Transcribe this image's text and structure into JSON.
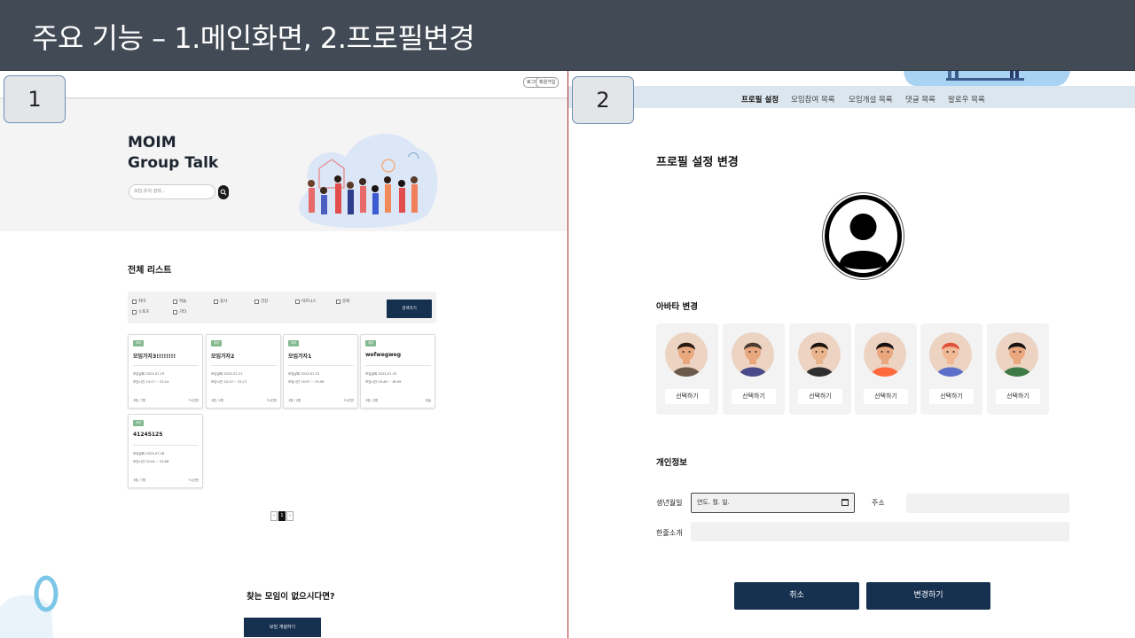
{
  "slide": {
    "title": "주요 기능 – 1.메인화면, 2.프로필변경"
  },
  "labels": {
    "left": "1",
    "right": "2"
  },
  "main": {
    "topbar": {
      "login": "로그인",
      "signup": "회원가입"
    },
    "brand": {
      "line1": "MOIM",
      "line2": "Group Talk"
    },
    "search": {
      "placeholder": "모임,유저 검색..."
    },
    "list_title": "전체 리스트",
    "filters": [
      "취미",
      "학습",
      "봉사",
      "건강",
      "비즈니스",
      "문화",
      "스포츠",
      "기타"
    ],
    "search_button": "검색하기",
    "cards": [
      {
        "tag": "취미",
        "title": "모임가자3!!!!!!!!",
        "line1": "모임날짜 2023-07-19",
        "line2": "모임시간 13:17 ~ 22:14",
        "count": "1명 / 7명",
        "date": "7시간전"
      },
      {
        "tag": "취미",
        "title": "모임가자2",
        "line1": "모임날짜 2023-07-21",
        "line2": "모임시간 10:13 ~ 22:17",
        "count": "1명 / 2명",
        "date": "7시간전"
      },
      {
        "tag": "취미",
        "title": "모임가자1",
        "line1": "모임날짜 2023-07-22",
        "line2": "모임시간 15:57 ~ 23:56",
        "count": "1명 / 2명",
        "date": "7시간전"
      },
      {
        "tag": "취미",
        "title": "wefwegweg",
        "line1": "모임날짜 2023-07-25",
        "line2": "모임시간 03:48 ~ 18:49",
        "count": "1명 / 2명",
        "date": "오늘"
      },
      {
        "tag": "취미",
        "title": "41245125",
        "line1": "모임날짜 2023-07-28",
        "line2": "모임시간 22:04 ~ 23:08",
        "count": "1명 / 7명",
        "date": "7시간전"
      }
    ],
    "pagination": {
      "prev": "‹",
      "current": "1",
      "next": "›"
    },
    "not_found": "찾는 모임이 없으시다면?",
    "create_button": "모임 개설하기"
  },
  "profile": {
    "nav": [
      "프로필 설정",
      "모임참여 목록",
      "모임개설 목록",
      "댓글 목록",
      "팔로우 목록"
    ],
    "title": "프로필 설정 변경",
    "avatar_title": "아바타 변경",
    "avatars": [
      {
        "select": "선택하기",
        "bg": "#ecd3c2",
        "skin": "#e9a77e",
        "hair": "#2a1b12",
        "shirt": "#6b5a4a"
      },
      {
        "select": "선택하기",
        "bg": "#ecd3c2",
        "skin": "#e9a77e",
        "hair": "#4a3a30",
        "shirt": "#4a4a8a"
      },
      {
        "select": "선택하기",
        "bg": "#ecd3c2",
        "skin": "#e9b48c",
        "hair": "#1d1410",
        "shirt": "#2f2f2f"
      },
      {
        "select": "선택하기",
        "bg": "#ecd3c2",
        "skin": "#e9a77e",
        "hair": "#1a1212",
        "shirt": "#ff6a3d"
      },
      {
        "select": "선택하기",
        "bg": "#ecd3c2",
        "skin": "#f0b895",
        "hair": "#e0533a",
        "shirt": "#5d6fc9"
      },
      {
        "select": "선택하기",
        "bg": "#ecd3c2",
        "skin": "#e9a77e",
        "hair": "#1a1212",
        "shirt": "#3e7a45"
      }
    ],
    "personal_title": "개인정보",
    "birth_label": "생년월일",
    "birth_placeholder": "연도. 월. 일.",
    "address_label": "주소",
    "intro_label": "한줄소개",
    "cancel_button": "취소",
    "change_button": "변경하기"
  },
  "colors": {
    "title_bar": "#414a55",
    "primary": "#16304f",
    "tag_green": "#84b88e",
    "divider": "#b22a2a",
    "nav_bg": "#dce6ee"
  }
}
